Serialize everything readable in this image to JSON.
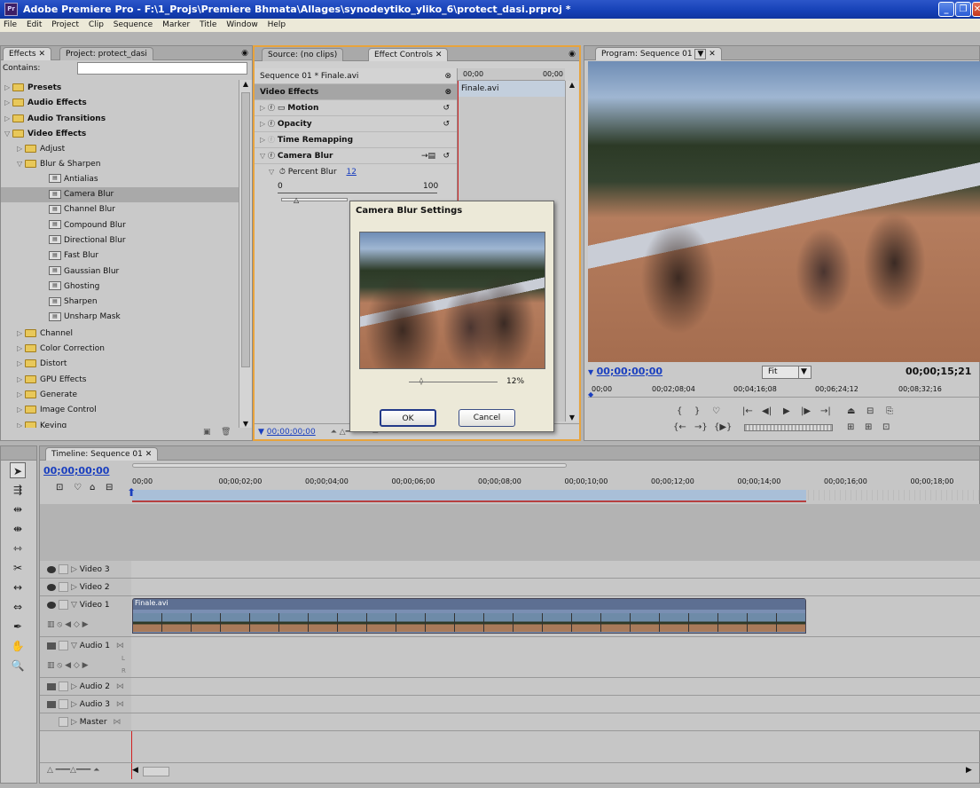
{
  "app": {
    "title": "Adobe Premiere Pro - F:\\1_Projs\\Premiere Bhmata\\Allages\\synodeytiko_yliko_6\\protect_dasi.prproj *",
    "icon": "premiere-pro-icon"
  },
  "menu": [
    "File",
    "Edit",
    "Project",
    "Clip",
    "Sequence",
    "Marker",
    "Title",
    "Window",
    "Help"
  ],
  "effects_panel": {
    "tabs": [
      "Effects",
      "Project: protect_dasi"
    ],
    "contains_label": "Contains:",
    "search_value": "",
    "tree": [
      {
        "label": "Presets",
        "level": 0,
        "bold": true,
        "expanded": false,
        "kind": "folder"
      },
      {
        "label": "Audio Effects",
        "level": 0,
        "bold": true,
        "expanded": false,
        "kind": "folder"
      },
      {
        "label": "Audio Transitions",
        "level": 0,
        "bold": true,
        "expanded": false,
        "kind": "folder"
      },
      {
        "label": "Video Effects",
        "level": 0,
        "bold": true,
        "expanded": true,
        "kind": "folder"
      },
      {
        "label": "Adjust",
        "level": 1,
        "expanded": false,
        "kind": "folder"
      },
      {
        "label": "Blur & Sharpen",
        "level": 1,
        "expanded": true,
        "kind": "folder"
      },
      {
        "label": "Antialias",
        "level": 2,
        "kind": "effect"
      },
      {
        "label": "Camera Blur",
        "level": 2,
        "kind": "effect",
        "selected": true
      },
      {
        "label": "Channel Blur",
        "level": 2,
        "kind": "effect"
      },
      {
        "label": "Compound Blur",
        "level": 2,
        "kind": "effect"
      },
      {
        "label": "Directional Blur",
        "level": 2,
        "kind": "effect"
      },
      {
        "label": "Fast Blur",
        "level": 2,
        "kind": "effect"
      },
      {
        "label": "Gaussian Blur",
        "level": 2,
        "kind": "effect"
      },
      {
        "label": "Ghosting",
        "level": 2,
        "kind": "effect"
      },
      {
        "label": "Sharpen",
        "level": 2,
        "kind": "effect"
      },
      {
        "label": "Unsharp Mask",
        "level": 2,
        "kind": "effect"
      },
      {
        "label": "Channel",
        "level": 1,
        "expanded": false,
        "kind": "folder"
      },
      {
        "label": "Color Correction",
        "level": 1,
        "expanded": false,
        "kind": "folder"
      },
      {
        "label": "Distort",
        "level": 1,
        "expanded": false,
        "kind": "folder"
      },
      {
        "label": "GPU Effects",
        "level": 1,
        "expanded": false,
        "kind": "folder"
      },
      {
        "label": "Generate",
        "level": 1,
        "expanded": false,
        "kind": "folder"
      },
      {
        "label": "Image Control",
        "level": 1,
        "expanded": false,
        "kind": "folder"
      },
      {
        "label": "Keying",
        "level": 1,
        "expanded": false,
        "kind": "folder"
      }
    ]
  },
  "effect_controls": {
    "tabs": [
      "Source: (no clips)",
      "Effect Controls"
    ],
    "sequence_label": "Sequence 01 * Finale.avi",
    "time_start": "00;00",
    "time_end": "00;00",
    "clip_name": "Finale.avi",
    "section": "Video Effects",
    "rows": [
      {
        "label": "Motion",
        "expanded": false
      },
      {
        "label": "Opacity",
        "expanded": false
      },
      {
        "label": "Time Remapping",
        "expanded": false
      },
      {
        "label": "Camera Blur",
        "expanded": true
      }
    ],
    "param_label": "Percent Blur",
    "param_value": "12",
    "slider_min": "0",
    "slider_max": "100",
    "timecode": "00;00;00;00"
  },
  "dialog": {
    "title": "Camera Blur Settings",
    "percent": "12%",
    "ok": "OK",
    "cancel": "Cancel",
    "slider_fraction": 0.12
  },
  "program": {
    "tab": "Program: Sequence 01",
    "timecode": "00;00;00;00",
    "fit": "Fit",
    "duration": "00;00;15;21",
    "ruler": [
      "00;00",
      "00;02;08;04",
      "00;04;16;08",
      "00;06;24;12",
      "00;08;32;16"
    ]
  },
  "timeline": {
    "tab": "Timeline: Sequence 01",
    "timecode": "00;00;00;00",
    "ruler": [
      "00;00",
      "00;00;02;00",
      "00;00;04;00",
      "00;00;06;00",
      "00;00;08;00",
      "00;00;10;00",
      "00;00;12;00",
      "00;00;14;00",
      "00;00;16;00",
      "00;00;18;00",
      "00"
    ],
    "tracks": [
      {
        "name": "Video 3",
        "type": "video"
      },
      {
        "name": "Video 2",
        "type": "video"
      },
      {
        "name": "Video 1",
        "type": "video",
        "expanded": true
      },
      {
        "name": "Audio 1",
        "type": "audio",
        "expanded": true
      },
      {
        "name": "Audio 2",
        "type": "audio"
      },
      {
        "name": "Audio 3",
        "type": "audio"
      },
      {
        "name": "Master",
        "type": "master"
      }
    ],
    "clip_name": "Finale.avi",
    "audio_lr": [
      "L",
      "R"
    ]
  },
  "tools": [
    "selection-tool",
    "track-select-tool",
    "ripple-edit-tool",
    "rolling-edit-tool",
    "rate-stretch-tool",
    "razor-tool",
    "slip-tool",
    "slide-tool",
    "pen-tool",
    "hand-tool",
    "zoom-tool"
  ],
  "colors": {
    "title_bar": "#1540b6",
    "timecode_blue": "#1a3fbf",
    "playhead": "#d02020",
    "panel": "#c9c9c9",
    "highlight_border": "#e8a33c"
  }
}
